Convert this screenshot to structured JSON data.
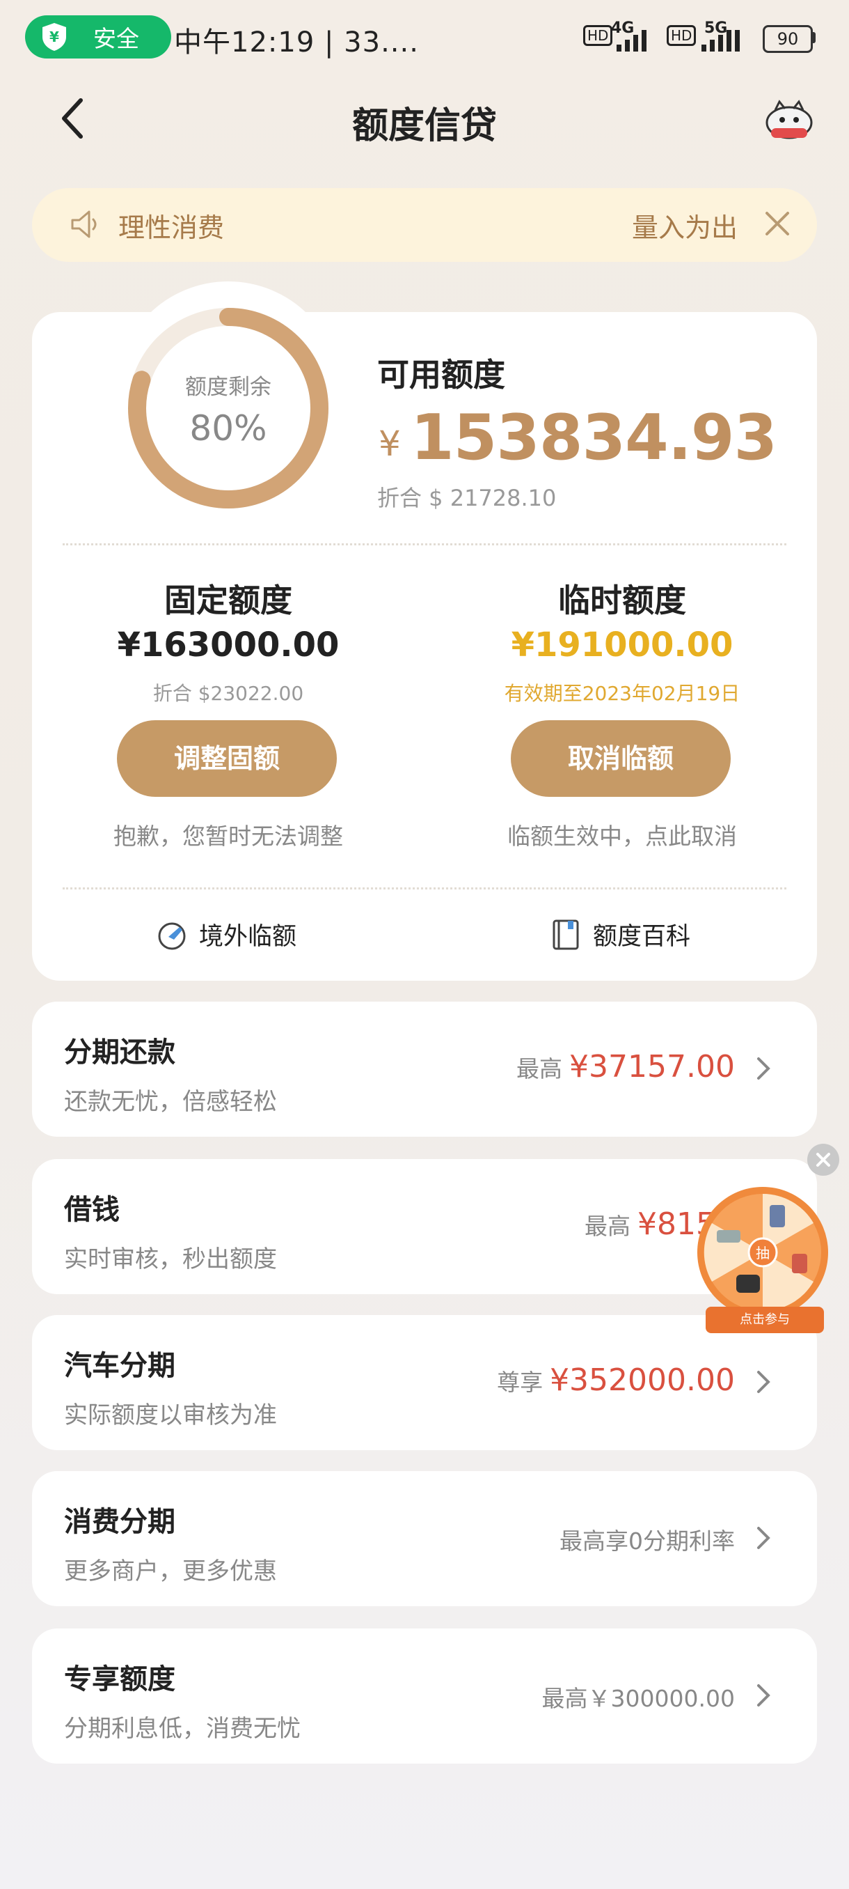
{
  "status_bar": {
    "security_label": "安全",
    "text": "中午12:19 | 33....",
    "net1": "4G",
    "net2": "5G",
    "hd": "HD",
    "battery": "90"
  },
  "header": {
    "title": "额度信贷"
  },
  "notice": {
    "left_text": "理性消费",
    "right_text": "量入为出"
  },
  "credit": {
    "ring_label": "额度剩余",
    "ring_percent": "80%",
    "ring_fraction": 0.8,
    "available_label": "可用额度",
    "available_currency": "¥",
    "available_amount": "153834.93",
    "available_converted": "折合 $ 21728.10"
  },
  "fixed": {
    "title": "固定额度",
    "amount": "¥163000.00",
    "converted": "折合 $23022.00",
    "button": "调整固额",
    "note": "抱歉，您暂时无法调整"
  },
  "temp": {
    "title": "临时额度",
    "amount": "¥191000.00",
    "validity": "有效期至2023年02月19日",
    "button": "取消临额",
    "note": "临额生效中，点此取消"
  },
  "links": {
    "overseas": "境外临额",
    "wiki": "额度百科"
  },
  "rows": [
    {
      "title": "分期还款",
      "subtitle": "还款无忧，倍感轻松",
      "prefix": "最高",
      "value": "¥37157.00"
    },
    {
      "title": "借钱",
      "subtitle": "实时审核，秒出额度",
      "prefix": "最高",
      "value": "¥8150"
    },
    {
      "title": "汽车分期",
      "subtitle": "实际额度以审核为准",
      "prefix": "尊享",
      "value": "¥352000.00"
    },
    {
      "title": "消费分期",
      "subtitle": "更多商户，更多优惠",
      "prefix": "最高享0分期利率",
      "value": ""
    },
    {
      "title": "专享额度",
      "subtitle": "分期利息低，消费无忧",
      "prefix": "最高￥300000.00",
      "value": ""
    }
  ],
  "floating": {
    "wheel_center": "抽",
    "tag": "点击参与"
  },
  "colors": {
    "gold": "#c09060",
    "yellow": "#e8b020",
    "red": "#d9503f",
    "green": "#15b86a"
  }
}
